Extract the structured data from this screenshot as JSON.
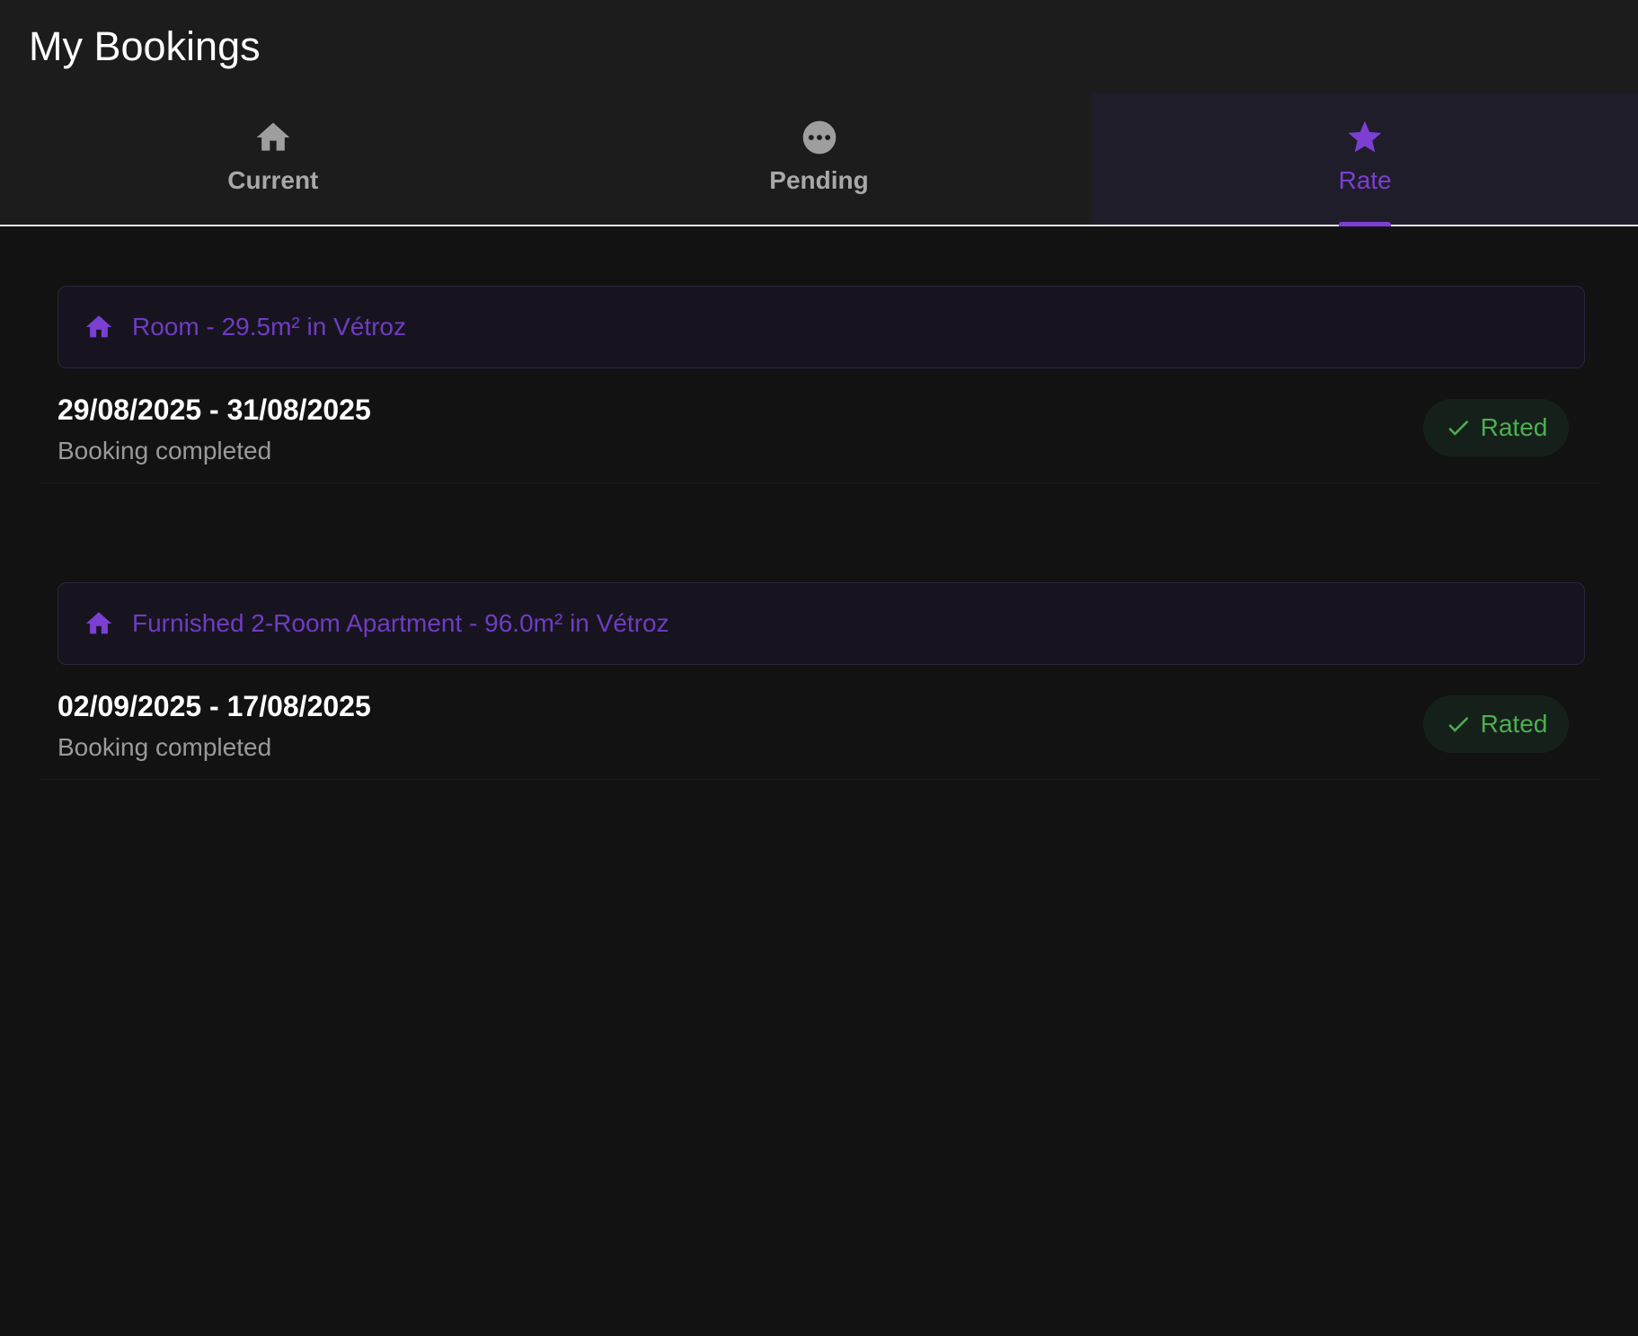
{
  "app": {
    "title": "My Bookings"
  },
  "tabs": [
    {
      "label": "Current",
      "icon": "home-icon",
      "active": false
    },
    {
      "label": "Pending",
      "icon": "more-horizontal-icon",
      "active": false
    },
    {
      "label": "Rate",
      "icon": "star-icon",
      "active": true
    }
  ],
  "bookings": [
    {
      "property": "Room - 29.5m² in Vétroz",
      "dates": "29/08/2025 - 31/08/2025",
      "status": "Booking completed",
      "badge": "Rated"
    },
    {
      "property": "Furnished 2-Room Apartment - 96.0m² in Vétroz",
      "dates": "02/09/2025 - 17/08/2025",
      "status": "Booking completed",
      "badge": "Rated"
    }
  ],
  "colors": {
    "accent": "#7b3fd3",
    "rated": "#4caf50",
    "background": "#121212",
    "appbar": "#1c1c1d"
  }
}
